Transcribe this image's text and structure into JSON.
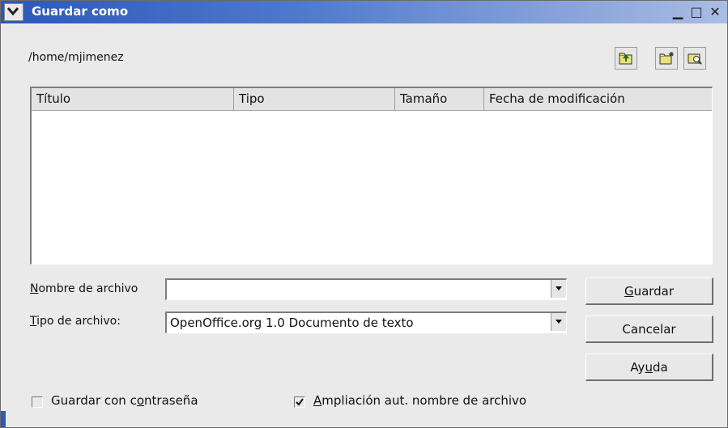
{
  "window": {
    "title": "Guardar como"
  },
  "path": "/home/mjimenez",
  "table": {
    "columns": [
      "Título",
      "Tipo",
      "Tamaño",
      "Fecha de modificación"
    ]
  },
  "filename": {
    "label_key": "N",
    "label_rest": "ombre de archivo",
    "value": ""
  },
  "filetype": {
    "label_key": "T",
    "label_rest": "ipo de archivo:",
    "value": "OpenOffice.org 1.0 Documento de texto"
  },
  "buttons": {
    "save_key": "G",
    "save_rest": "uardar",
    "cancel": "Cancelar",
    "help_pre": "Ay",
    "help_key": "u",
    "help_post": "da"
  },
  "checkboxes": {
    "password_pre": "Guardar con c",
    "password_key": "o",
    "password_post": "ntraseña",
    "password_checked": false,
    "ext_key": "A",
    "ext_rest": "mpliación aut. nombre de archivo",
    "ext_checked": true
  },
  "icons": [
    "menu-chevron-icon",
    "minimize-icon",
    "maximize-icon",
    "close-icon",
    "up-folder-icon",
    "new-folder-icon",
    "default-dir-icon",
    "dropdown-arrow-icon",
    "checkmark-icon"
  ]
}
